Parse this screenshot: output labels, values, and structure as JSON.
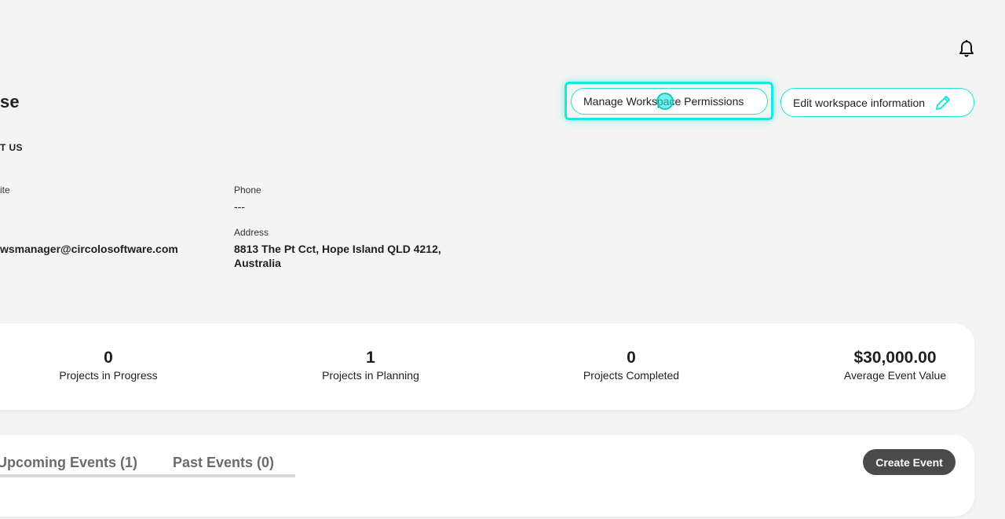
{
  "header": {
    "title": "se",
    "notification_icon": "bell-icon"
  },
  "actions": {
    "manage_permissions_label": "Manage Workspace Permissions",
    "edit_info_label": "Edit workspace information",
    "edit_icon": "pencil-icon",
    "accent_color": "#1ee5d5"
  },
  "about": {
    "heading": "T US",
    "fields": {
      "website_label": "ite",
      "phone_label": "Phone",
      "phone_value": "---",
      "email_value": "wsmanager@circolosoftware.com",
      "address_label": "Address",
      "address_line1": "8813 The Pt Cct, Hope Island QLD 4212,",
      "address_line2": "Australia"
    }
  },
  "stats": [
    {
      "value": "0",
      "caption": "Projects in Progress"
    },
    {
      "value": "1",
      "caption": "Projects in Planning"
    },
    {
      "value": "0",
      "caption": "Projects Completed"
    },
    {
      "value": "$30,000.00",
      "caption": "Average Event Value"
    }
  ],
  "events": {
    "tabs": [
      {
        "label": "Upcoming Events (1)"
      },
      {
        "label": "Past Events (0)"
      }
    ],
    "create_label": "Create Event"
  }
}
